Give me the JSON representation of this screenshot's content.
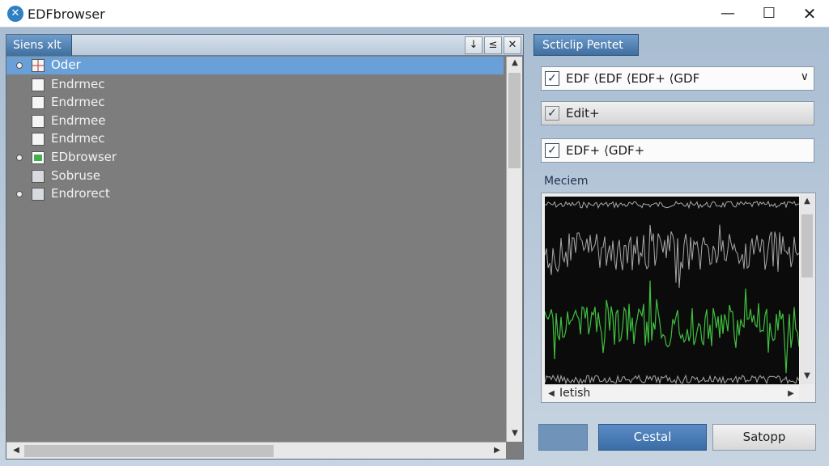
{
  "window": {
    "title": "EDFbrowser",
    "minimize": "—",
    "maximize": "☐",
    "close": "✕"
  },
  "left_panel": {
    "tab_label": "Siens xlt",
    "header_buttons": [
      "↓",
      "≤",
      "✕"
    ],
    "items": [
      {
        "label": "Oder",
        "icon": "grid-icon",
        "bullet": true,
        "selected": true
      },
      {
        "label": "Endrmec",
        "icon": "blank-icon",
        "bullet": false,
        "selected": false
      },
      {
        "label": "Endrmec",
        "icon": "blank-icon",
        "bullet": false,
        "selected": false
      },
      {
        "label": "Endrmee",
        "icon": "blank-icon",
        "bullet": false,
        "selected": false
      },
      {
        "label": "Endrmec",
        "icon": "blank-icon",
        "bullet": false,
        "selected": false
      },
      {
        "label": "EDbrowser",
        "icon": "green-signal-icon",
        "bullet": true,
        "selected": false
      },
      {
        "label": "Sobruse",
        "icon": "blank-icon",
        "bullet": false,
        "selected": false
      },
      {
        "label": "Endrorect",
        "icon": "document-icon",
        "bullet": true,
        "selected": false
      }
    ]
  },
  "right_panel": {
    "tab_label": "Scticlip Pentet",
    "dropdown": {
      "checked": true,
      "value": "EDF ⟨EDF ⟨EDF+ ⟨GDF",
      "arrow": "∨"
    },
    "field2": {
      "checked": true,
      "value": "Edit+"
    },
    "field3": {
      "checked": true,
      "value": "EDF+ ⟨GDF+"
    },
    "section_label": "Meciem",
    "scroll_label": "Ietish",
    "colors": {
      "signal_gray": "#a9a9a9",
      "signal_green": "#3fbf3f",
      "plot_bg": "#0b0b0b"
    }
  },
  "buttons": {
    "blank": "",
    "cestal": "Cestal",
    "satopp": "Satopp"
  }
}
